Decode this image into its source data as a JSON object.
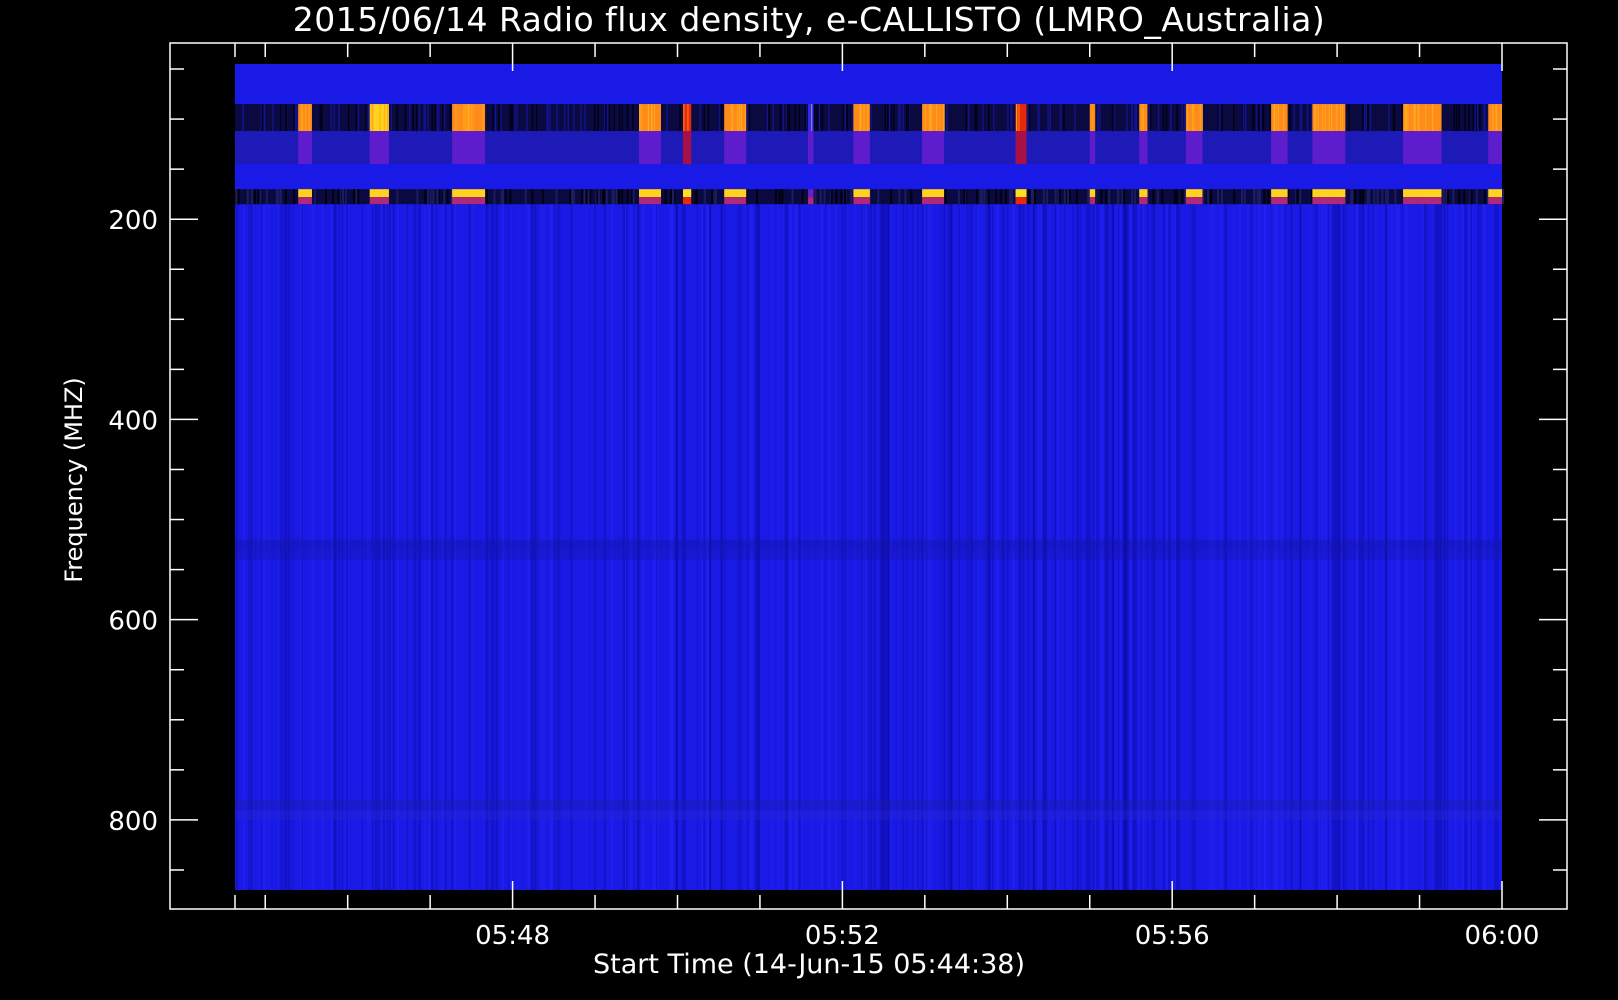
{
  "chart_data": {
    "type": "heatmap",
    "title": "2015/06/14  Radio flux density, e-CALLISTO (LMRO_Australia)",
    "xlabel": "Start Time (14-Jun-15 05:44:38)",
    "ylabel": "Frequency (MHZ)",
    "x_unit": "UT time",
    "xlim": [
      "05:44:38",
      "06:00:00"
    ],
    "ylim": [
      45,
      870
    ],
    "y_axis_inverted": true,
    "x_ticks": [
      "05:48",
      "05:52",
      "05:56",
      "06:00"
    ],
    "y_ticks": [
      200,
      400,
      600,
      800
    ],
    "colormap": "blue-red-yellow (background blue, bursts orange/yellow)",
    "background_color": "#1a1ae6",
    "frame_color": "#ffffff",
    "interference_bands_mhz": [
      {
        "from": 85,
        "to": 112,
        "intensity": "high"
      },
      {
        "from": 112,
        "to": 145,
        "intensity": "medium"
      },
      {
        "from": 170,
        "to": 185,
        "intensity": "high"
      }
    ],
    "bursts": [
      {
        "start": "05:45:24",
        "end": "05:45:34",
        "peak": "orange"
      },
      {
        "start": "05:46:16",
        "end": "05:46:30",
        "peak": "yellow"
      },
      {
        "start": "05:47:16",
        "end": "05:47:40",
        "peak": "orange"
      },
      {
        "start": "05:49:32",
        "end": "05:49:48",
        "peak": "orange"
      },
      {
        "start": "05:50:04",
        "end": "05:50:10",
        "peak": "red"
      },
      {
        "start": "05:50:34",
        "end": "05:50:50",
        "peak": "orange"
      },
      {
        "start": "05:51:35",
        "end": "05:51:39",
        "peak": "blue"
      },
      {
        "start": "05:52:08",
        "end": "05:52:20",
        "peak": "orange"
      },
      {
        "start": "05:52:58",
        "end": "05:53:14",
        "peak": "orange"
      },
      {
        "start": "05:54:06",
        "end": "05:54:14",
        "peak": "red"
      },
      {
        "start": "05:55:00",
        "end": "05:55:04",
        "peak": "orange"
      },
      {
        "start": "05:55:36",
        "end": "05:55:42",
        "peak": "orange"
      },
      {
        "start": "05:56:10",
        "end": "05:56:22",
        "peak": "orange"
      },
      {
        "start": "05:57:12",
        "end": "05:57:24",
        "peak": "orange"
      },
      {
        "start": "05:57:42",
        "end": "05:58:06",
        "peak": "orange"
      },
      {
        "start": "05:58:48",
        "end": "05:59:16",
        "peak": "orange"
      },
      {
        "start": "05:59:50",
        "end": "06:00:00",
        "peak": "orange"
      }
    ]
  }
}
